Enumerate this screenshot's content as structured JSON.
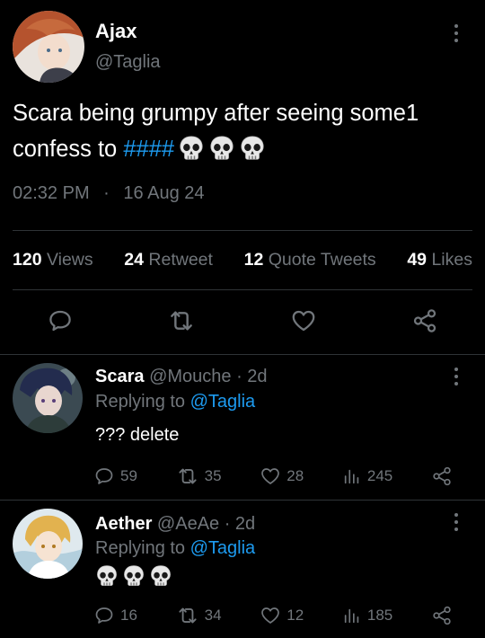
{
  "main": {
    "author_name": "Ajax",
    "author_handle": "@Taglia",
    "text_line1": "Scara being grumpy after seeing some1",
    "text_line2_prefix": "confess to ",
    "hashtag": "####",
    "timestamp": "02:32 PM",
    "separator": "·",
    "date": "16 Aug 24",
    "stats": {
      "views_count": "120",
      "views_label": "Views",
      "retweet_count": "24",
      "retweet_label": "Retweet",
      "quote_count": "12",
      "quote_label": "Quote Tweets",
      "likes_count": "49",
      "likes_label": "Likes"
    }
  },
  "replies": [
    {
      "name": "Scara",
      "handle_time": "@Mouche · 2d",
      "replying_prefix": "Replying to",
      "replying_handle": "@Taglia",
      "text": "??? delete",
      "replies": "59",
      "retweets": "35",
      "likes": "28",
      "views": "245"
    },
    {
      "name": "Aether",
      "handle_time": "@AeAe · 2d",
      "replying_prefix": "Replying to",
      "replying_handle": "@Taglia",
      "text": "",
      "replies": "16",
      "retweets": "34",
      "likes": "12",
      "views": "185"
    }
  ],
  "icons": {
    "reply": "speech-bubble-icon",
    "retweet": "retweet-arrows-icon",
    "like": "heart-icon",
    "views": "bar-chart-icon",
    "share": "share-nodes-icon",
    "more": "vertical-dots-icon",
    "emoji": "skull-emoji"
  },
  "colors": {
    "background": "#000000",
    "text": "#e7e9ea",
    "muted": "#71767b",
    "accent": "#1d9bf0",
    "divider": "#2f3336"
  }
}
